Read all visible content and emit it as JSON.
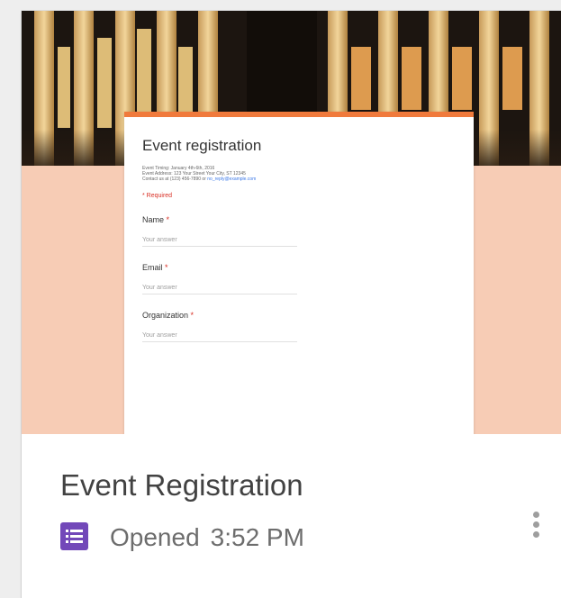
{
  "card": {
    "title": "Event Registration",
    "status_label": "Opened",
    "status_time": "3:52 PM",
    "icon": "google-forms-icon",
    "more_icon": "more-vert-icon",
    "accent": "#7248b9"
  },
  "thumbnail": {
    "theme_color": "#f07a3c",
    "background_color": "#f7ccb5",
    "form": {
      "title": "Event registration",
      "description": [
        "Event Timing: January 4th-6th, 2016",
        "Event Address: 123 Your Street Your City, ST 12345",
        "Contact us at (123) 456-7890 or"
      ],
      "description_link": "no_reply@example.com",
      "required_note": "* Required",
      "questions": [
        {
          "label": "Name",
          "star": "*",
          "placeholder": "Your answer"
        },
        {
          "label": "Email",
          "star": "*",
          "placeholder": "Your answer"
        },
        {
          "label": "Organization",
          "star": "*",
          "placeholder": "Your answer"
        }
      ]
    }
  }
}
